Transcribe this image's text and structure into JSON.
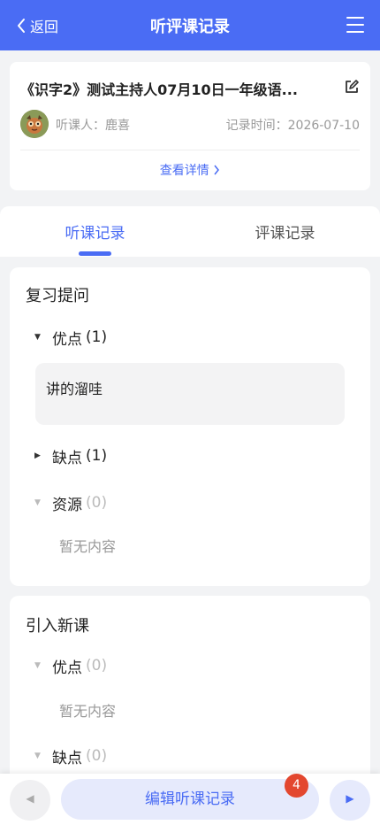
{
  "navbar": {
    "back_label": "返回",
    "title": "听评课记录"
  },
  "record": {
    "title": "《识字2》测试主持人07月10日一年级语...",
    "listener": "听课人：鹿喜",
    "record_time": "记录时间：2026-07-10",
    "detail_link": "查看详情"
  },
  "tabs": [
    {
      "label": "听课记录",
      "active": true
    },
    {
      "label": "评课记录",
      "active": false
    }
  ],
  "sections": [
    {
      "title": "复习提问",
      "groups": [
        {
          "label": "优点",
          "count": "(1)",
          "expanded": true,
          "entries": [
            "讲的溜哇"
          ]
        },
        {
          "label": "缺点",
          "count": "(1)",
          "expanded": false
        },
        {
          "label": "资源",
          "count": "(0)",
          "empty_text": "暂无内容"
        }
      ]
    },
    {
      "title": "引入新课",
      "groups": [
        {
          "label": "优点",
          "count": "(0)",
          "empty_text": "暂无内容"
        },
        {
          "label": "缺点",
          "count": "(0)"
        }
      ]
    }
  ],
  "bottom": {
    "edit_label": "编辑听课记录",
    "badge_count": "4"
  },
  "colors": {
    "accent": "#4a6cf4",
    "badge": "#e3472f",
    "background": "#f2f3f5"
  },
  "icons": [
    "chevron-left-icon",
    "menu-icon",
    "edit-icon",
    "triangle-down-icon",
    "triangle-right-icon",
    "chevron-right-icon",
    "play-left-icon",
    "play-right-icon"
  ]
}
